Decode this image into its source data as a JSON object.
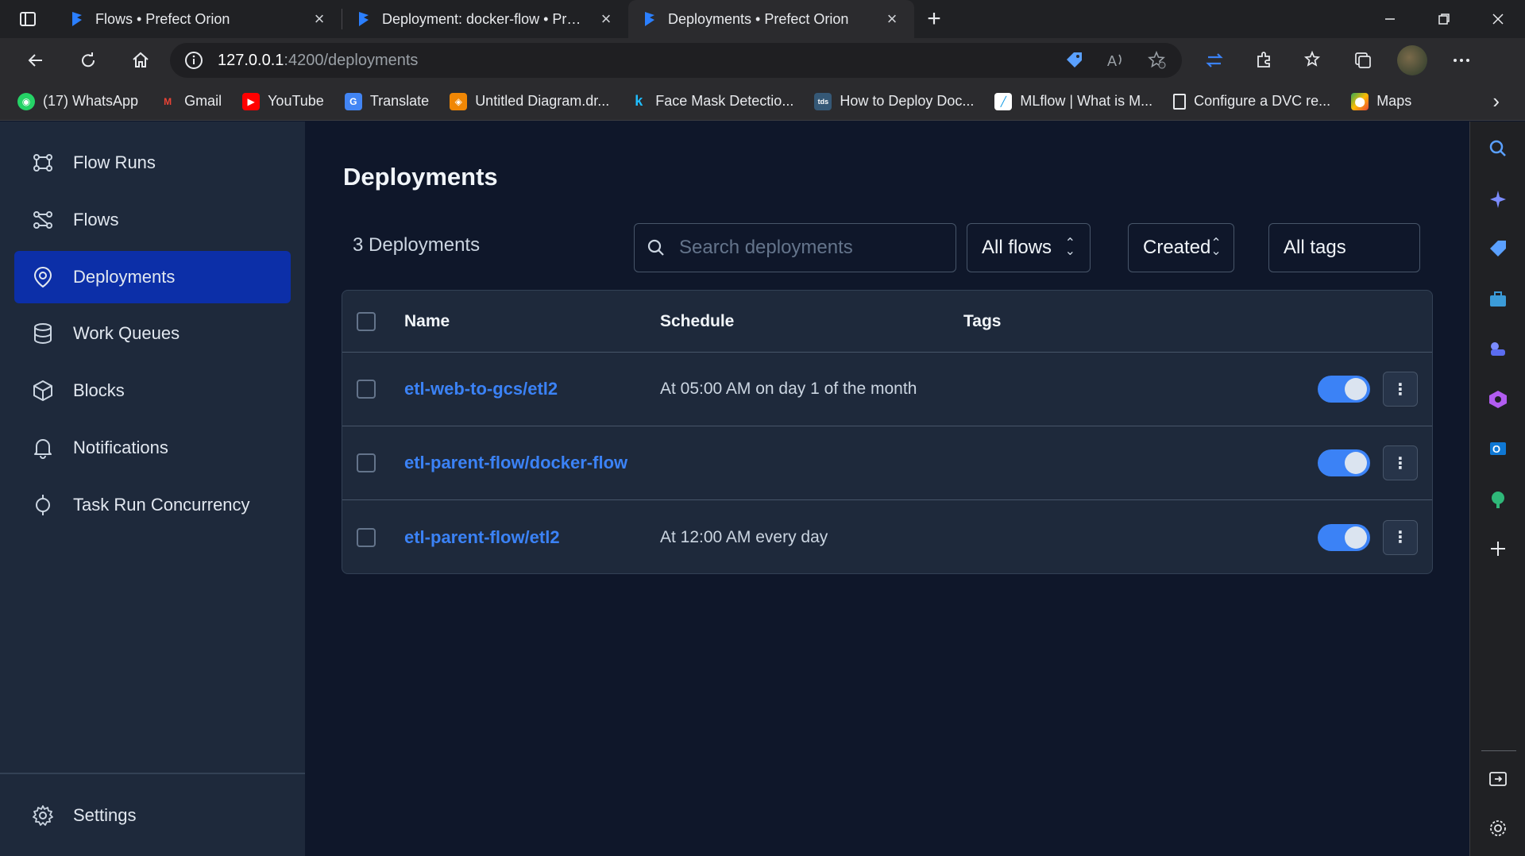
{
  "browser": {
    "tabs": [
      {
        "title": "Flows • Prefect Orion",
        "active": false
      },
      {
        "title": "Deployment: docker-flow • Prefect Orion",
        "active": false
      },
      {
        "title": "Deployments • Prefect Orion",
        "active": true
      }
    ],
    "url_host": "127.0.0.1",
    "url_path": ":4200/deployments",
    "bookmarks": [
      {
        "label": "(17) WhatsApp",
        "icon": "whatsapp-icon",
        "color": "#25d366"
      },
      {
        "label": "Gmail",
        "icon": "gmail-icon",
        "color": "#ea4335"
      },
      {
        "label": "YouTube",
        "icon": "youtube-icon",
        "color": "#ff0000"
      },
      {
        "label": "Translate",
        "icon": "translate-icon",
        "color": "#4285f4"
      },
      {
        "label": "Untitled Diagram.dr...",
        "icon": "drawio-icon",
        "color": "#f08705"
      },
      {
        "label": "Face Mask Detectio...",
        "icon": "kaggle-icon",
        "color": "#20beff"
      },
      {
        "label": "How to Deploy Doc...",
        "icon": "tds-icon",
        "color": "#355876"
      },
      {
        "label": "MLflow | What is M...",
        "icon": "mlflow-icon",
        "color": "#ffffff"
      },
      {
        "label": "Configure a DVC re...",
        "icon": "page-icon",
        "color": "#e8eaed"
      },
      {
        "label": "Maps",
        "icon": "maps-icon",
        "color": "#34a853"
      }
    ]
  },
  "sidebar": {
    "items": [
      {
        "label": "Flow Runs",
        "icon": "flow-runs-icon",
        "active": false
      },
      {
        "label": "Flows",
        "icon": "flows-icon",
        "active": false
      },
      {
        "label": "Deployments",
        "icon": "deployments-icon",
        "active": true
      },
      {
        "label": "Work Queues",
        "icon": "database-icon",
        "active": false
      },
      {
        "label": "Blocks",
        "icon": "cube-icon",
        "active": false
      },
      {
        "label": "Notifications",
        "icon": "bell-icon",
        "active": false
      },
      {
        "label": "Task Run Concurrency",
        "icon": "concurrency-icon",
        "active": false
      }
    ],
    "settings_label": "Settings"
  },
  "main": {
    "title": "Deployments",
    "count_label": "3 Deployments",
    "search_placeholder": "Search deployments",
    "flows_filter": "All flows",
    "sort_filter": "Created",
    "tags_filter": "All tags",
    "table": {
      "headers": {
        "name": "Name",
        "schedule": "Schedule",
        "tags": "Tags"
      },
      "rows": [
        {
          "name": "etl-web-to-gcs/etl2",
          "schedule": "At 05:00 AM on day 1 of the month",
          "enabled": true
        },
        {
          "name": "etl-parent-flow/docker-flow",
          "schedule": "",
          "enabled": true
        },
        {
          "name": "etl-parent-flow/etl2",
          "schedule": "At 12:00 AM every day",
          "enabled": true
        }
      ]
    }
  },
  "colors": {
    "accent": "#3b82f6",
    "active_nav": "#0c2fa8",
    "sidebar_bg": "#1e293b",
    "main_bg": "#0f172a"
  }
}
